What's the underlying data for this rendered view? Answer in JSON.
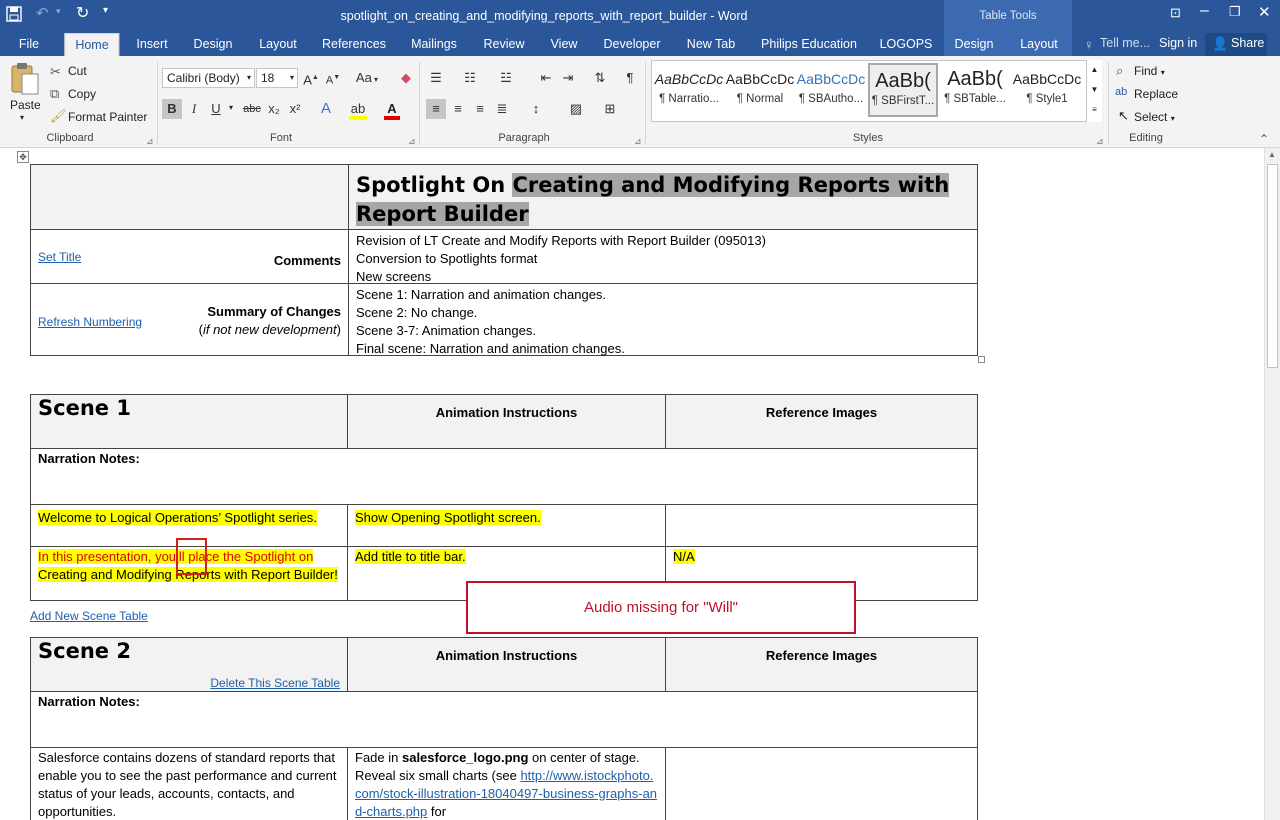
{
  "app": {
    "doc_title": "spotlight_on_creating_and_modifying_reports_with_report_builder - Word",
    "context_tools": "Table Tools"
  },
  "tabs": [
    "File",
    "Home",
    "Insert",
    "Design",
    "Layout",
    "References",
    "Mailings",
    "Review",
    "View",
    "Developer",
    "New Tab",
    "Philips Education",
    "LOGOPS",
    "Design",
    "Layout"
  ],
  "tell_me": "Tell me...",
  "sign_in": "Sign in",
  "share": "Share",
  "clipboard": {
    "paste": "Paste",
    "cut": "Cut",
    "copy": "Copy",
    "format_painter": "Format Painter",
    "label": "Clipboard"
  },
  "font": {
    "name": "Calibri (Body)",
    "size": "18",
    "label": "Font",
    "change_case": "Aa",
    "bold": "B",
    "italic": "I",
    "underline": "U",
    "strike": "abc",
    "sub": "x₂",
    "sup": "x²"
  },
  "paragraph": {
    "label": "Paragraph"
  },
  "styles": {
    "label": "Styles",
    "items": [
      {
        "preview": "AaBbCcDc",
        "name": "¶ Narratio..."
      },
      {
        "preview": "AaBbCcDc",
        "name": "¶ Normal"
      },
      {
        "preview": "AaBbCcDc",
        "name": "¶ SBAutho..."
      },
      {
        "preview": "AaBb(",
        "name": "¶ SBFirstT..."
      },
      {
        "preview": "AaBb(",
        "name": "¶ SBTable..."
      },
      {
        "preview": "AaBbCcDc",
        "name": "¶ Style1"
      }
    ]
  },
  "editing": {
    "find": "Find",
    "replace": "Replace",
    "select": "Select",
    "label": "Editing"
  },
  "doc": {
    "title_plain": "Spotlight On ",
    "title_selected": "Creating and Modifying Reports with Report Builder",
    "set_title": "Set Title ",
    "comments_label": "Comments",
    "comments": [
      "Revision of LT Create and Modify Reports with Report Builder (095013)",
      "Conversion to Spotlights format",
      "New screens"
    ],
    "refresh_numbering": "Refresh Numbering",
    "summary_label": "Summary of Changes",
    "summary_sub_open": "(",
    "summary_sub_italic": "if not new development",
    "summary_sub_close": ")",
    "changes": [
      "Scene 1: Narration and animation changes.",
      "Scene 2: No change.",
      "Scene 3-7: Animation changes.",
      "Final scene: Narration and animation changes."
    ],
    "scene1": {
      "title": "Scene 1",
      "anim_h": "Animation Instructions",
      "ref_h": "Reference Images",
      "narr_h": "Narration Notes:",
      "row1_narr": "Welcome to Logical Operations’ Spotlight series.",
      "row1_anim": "Show Opening Spotlight screen.",
      "row2_narr_red": "In this presentation, you’ll place the Spotlight on",
      "row2_narr_rest": "Creating and Modifying Reports with Report Builder!",
      "row2_anim": "Add title to title bar.",
      "row2_ref": "N/A"
    },
    "add_scene": "Add New Scene Table",
    "scene2": {
      "title": "Scene 2",
      "delete": "Delete This Scene Table",
      "anim_h": "Animation Instructions",
      "ref_h": "Reference Images",
      "narr_h": "Narration Notes:",
      "row1_narr": "Salesforce contains dozens of standard reports that enable you to see the past performance and current status of your leads, accounts, contacts, and opportunities.",
      "row1_anim_a": "Fade in ",
      "row1_anim_b": "salesforce_logo.png",
      "row1_anim_c": " on center of stage. Reveal six small charts (see ",
      "row1_anim_link": "http://www.istockphoto.com/stock-illustration-18040497-business-graphs-and-charts.php",
      "row1_anim_d": " for"
    },
    "callout": "Audio missing for \"Will\""
  }
}
